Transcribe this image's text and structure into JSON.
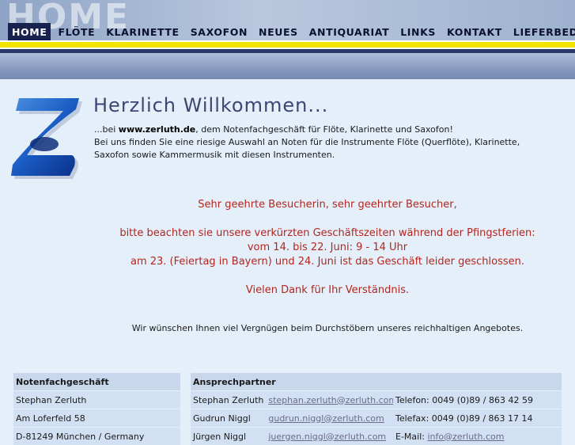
{
  "header": {
    "bg_text": "HOME",
    "nav": [
      "HOME",
      "FLÖTE",
      "KLARINETTE",
      "SAXOFON",
      "NEUES",
      "ANTIQUARIAT",
      "LINKS",
      "KONTAKT",
      "LIEFERBEDINGUNGEN"
    ]
  },
  "welcome": {
    "title": "Herzlich Willkommen...",
    "intro_prefix": "...bei ",
    "intro_site": "www.zerluth.de",
    "intro_suffix": ", dem Notenfachgeschäft für Flöte, Klarinette und Saxofon!",
    "intro_line2": "Bei uns finden Sie eine riesige Auswahl an Noten für die Instrumente Flöte (Querflöte), Klarinette, Saxofon sowie Kammermusik mit diesen Instrumenten."
  },
  "notice": {
    "greeting": "Sehr geehrte Besucherin, sehr geehrter Besucher,",
    "line1": "bitte beachten sie unsere verkürzten Geschäftszeiten während der Pfingstferien:",
    "line2": "vom 14. bis 22. Juni: 9 - 14 Uhr",
    "line3": "am 23. (Feiertag in Bayern) und 24. Juni ist das Geschäft leider geschlossen.",
    "thanks": "Vielen Dank für Ihr Verständnis."
  },
  "wish": "Wir wünschen Ihnen viel Vergnügen beim Durchstöbern unseres reichhaltigen Angebotes.",
  "shop": {
    "heading": "Notenfachgeschäft",
    "name": "Stephan Zerluth",
    "street": "Am Loferfeld 58",
    "city": "D-81249 München / Germany"
  },
  "contacts": {
    "heading": "Ansprechpartner",
    "rows": [
      {
        "name": "Stephan Zerluth",
        "email": "stephan.zerluth@zerluth.com"
      },
      {
        "name": "Gudrun Niggl",
        "email": "gudrun.niggl@zerluth.com"
      },
      {
        "name": "Jürgen Niggl",
        "email": "juergen.niggl@zerluth.com"
      }
    ]
  },
  "phone": {
    "telefon": "Telefon: 0049 (0)89 / 863 42 59",
    "telefax": "Telefax: 0049 (0)89 / 863 17 14",
    "email_label": "E-Mail: ",
    "email": "info@zerluth.com"
  },
  "colors": {
    "nav_active_bg": "#17224f",
    "stripe": "#f3e400",
    "notice_text": "#b3261e",
    "title": "#3d4572"
  }
}
